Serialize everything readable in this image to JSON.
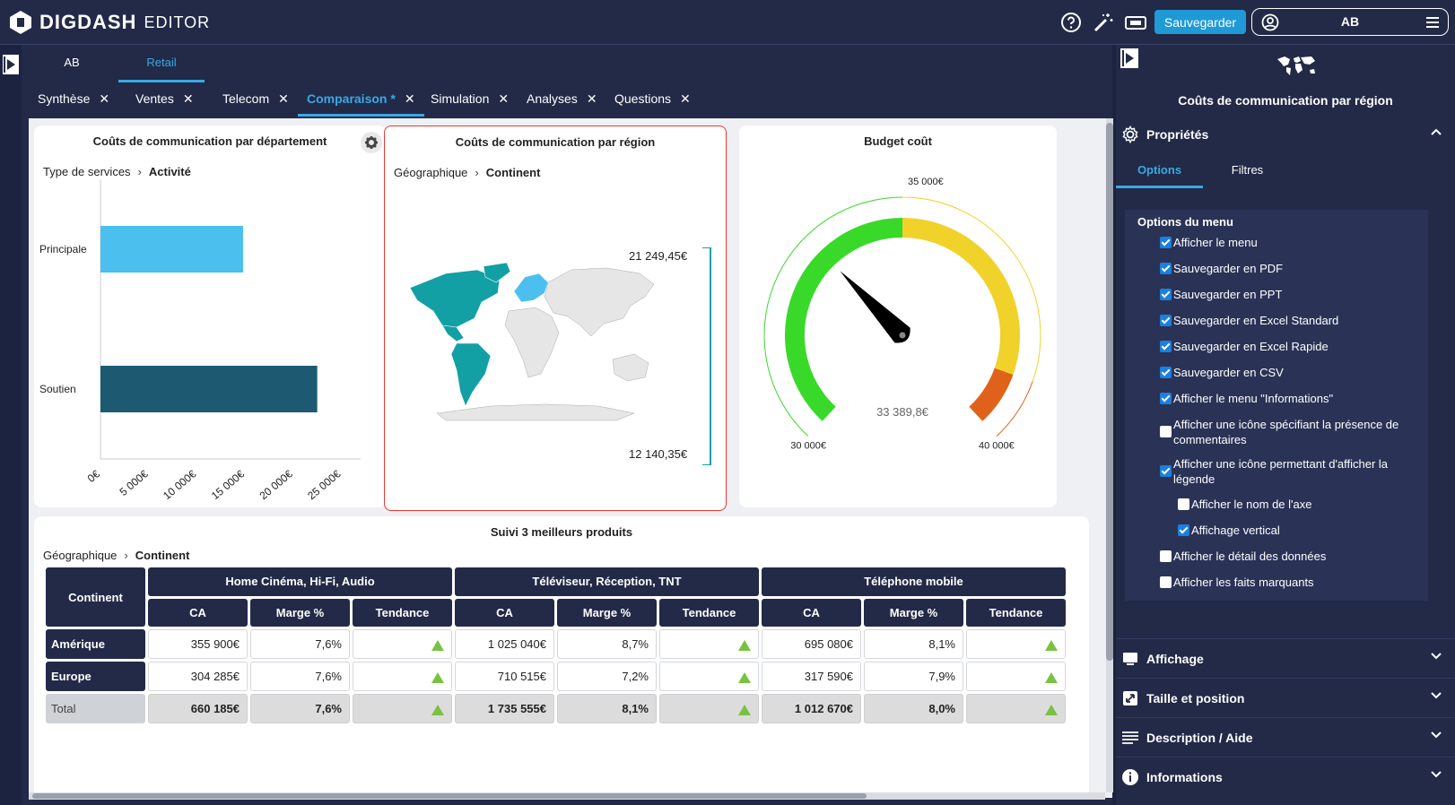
{
  "app": {
    "brand": "DIGDASH",
    "mode": "EDITOR",
    "save_label": "Sauvegarder",
    "user_initials": "AB"
  },
  "page_tabs": [
    {
      "label": "AB"
    },
    {
      "label": "Retail"
    }
  ],
  "sub_tabs": [
    {
      "label": "Synthèse"
    },
    {
      "label": "Ventes"
    },
    {
      "label": "Telecom"
    },
    {
      "label": "Comparaison *"
    },
    {
      "label": "Simulation"
    },
    {
      "label": "Analyses"
    },
    {
      "label": "Questions"
    }
  ],
  "close_glyph": "✕",
  "crumb_sep": "›",
  "dept_chart": {
    "crumb_a": "Type de services",
    "crumb_b": "Activité",
    "chart_data": {
      "type": "bar",
      "title": "Coûts de communication par département",
      "categories": [
        "Principale",
        "Soutien"
      ],
      "values": [
        14800,
        22500
      ],
      "colors": [
        "#4bbfee",
        "#1d5a72"
      ],
      "ticks": [
        "0€",
        "5 000€",
        "10 000€",
        "15 000€",
        "20 000€",
        "25 000€"
      ],
      "xlim": [
        0,
        27000
      ]
    }
  },
  "region_map": {
    "title": "Coûts de communication par région",
    "crumb_a": "Géographique",
    "crumb_b": "Continent",
    "legend_max": "21 249,45€",
    "legend_min": "12 140,35€"
  },
  "gauge": {
    "chart_data": {
      "type": "gauge",
      "title": "Budget coût",
      "value_label": "33 389,8€",
      "value": 33389.8,
      "min": 30000,
      "max": 40000,
      "min_label": "30 000€",
      "mid_label": "35 000€",
      "max_label": "40 000€",
      "bands": [
        {
          "from": 30000,
          "to": 35000,
          "color": "#39d92a"
        },
        {
          "from": 35000,
          "to": 39000,
          "color": "#f1d22a"
        },
        {
          "from": 39000,
          "to": 40000,
          "color": "#e0621a"
        }
      ]
    }
  },
  "table": {
    "title": "Suivi 3 meilleurs produits",
    "crumb_a": "Géographique",
    "crumb_b": "Continent",
    "row_header": "Continent",
    "groups": [
      "Home Cinéma, Hi-Fi, Audio",
      "Téléviseur, Réception, TNT",
      "Téléphone mobile"
    ],
    "subheaders": [
      "CA",
      "Marge %",
      "Tendance"
    ],
    "rows": [
      {
        "name": "Amérique",
        "vals": [
          "355 900€",
          "7,6%",
          "1 025 040€",
          "8,7%",
          "695 080€",
          "8,1%"
        ]
      },
      {
        "name": "Europe",
        "vals": [
          "304 285€",
          "7,6%",
          "710 515€",
          "7,2%",
          "317 590€",
          "7,9%"
        ]
      },
      {
        "name": "Total",
        "vals": [
          "660 185€",
          "7,6%",
          "1 735 555€",
          "8,1%",
          "1 012 670€",
          "8,0%"
        ]
      }
    ]
  },
  "panel": {
    "title": "Coûts de communication par région",
    "sections": {
      "props": "Propriétés",
      "display": "Affichage",
      "size": "Taille et position",
      "desc": "Description / Aide",
      "info": "Informations"
    },
    "tabs": [
      "Options",
      "Filtres"
    ],
    "group_title": "Options du menu",
    "options": [
      {
        "label": "Afficher le menu",
        "checked": true
      },
      {
        "label": "Sauvegarder en PDF",
        "checked": true
      },
      {
        "label": "Sauvegarder en PPT",
        "checked": true
      },
      {
        "label": "Sauvegarder en Excel Standard",
        "checked": true
      },
      {
        "label": "Sauvegarder en Excel Rapide",
        "checked": true
      },
      {
        "label": "Sauvegarder en CSV",
        "checked": true
      },
      {
        "label": "Afficher le menu \"Informations\"",
        "checked": true
      },
      {
        "label": "Afficher une icône spécifiant la présence de commentaires",
        "checked": false
      },
      {
        "label": "Afficher une icône permettant d'afficher la légende",
        "checked": true
      },
      {
        "label": "Afficher le nom de l'axe",
        "checked": false
      },
      {
        "label": "Affichage vertical",
        "checked": true
      },
      {
        "label": "Afficher le détail des données",
        "checked": false
      },
      {
        "label": "Afficher les faits marquants",
        "checked": false
      }
    ]
  }
}
